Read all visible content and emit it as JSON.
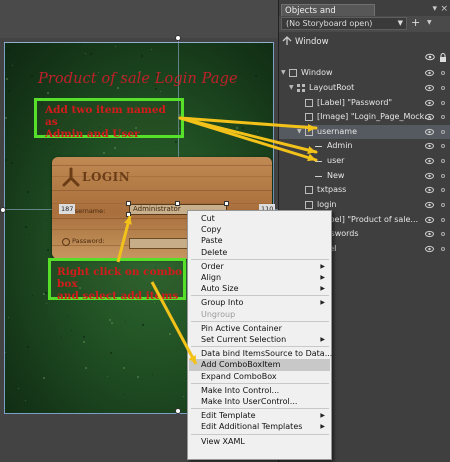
{
  "canvas": {
    "page_title": "Product of sale Login Page",
    "login_word": "LOGIN",
    "username_label": "Username:",
    "username_combo_text": "Administrator",
    "password_label": "Password:",
    "ruler_left": "187",
    "ruler_right": "110",
    "callout_top": [
      "Add two item named as",
      "Admin and User"
    ],
    "callout_bottom": [
      "Right click on combo box",
      "and select add items"
    ],
    "callout_color": "#56e02a",
    "callout_text_color": "#d41b1b",
    "arrow_color": "#f2c21a"
  },
  "context_menu": {
    "items": [
      {
        "label": "Cut",
        "submenu": false,
        "disabled": false
      },
      {
        "label": "Copy",
        "submenu": false,
        "disabled": false
      },
      {
        "label": "Paste",
        "submenu": false,
        "disabled": false
      },
      {
        "label": "Delete",
        "submenu": false,
        "disabled": false
      },
      {
        "label": "Order",
        "submenu": true,
        "disabled": false
      },
      {
        "label": "Align",
        "submenu": true,
        "disabled": false
      },
      {
        "label": "Auto Size",
        "submenu": true,
        "disabled": false
      },
      {
        "label": "Group Into",
        "submenu": true,
        "disabled": false
      },
      {
        "label": "Ungroup",
        "submenu": false,
        "disabled": true
      },
      {
        "label": "Pin Active Container",
        "submenu": false,
        "disabled": false
      },
      {
        "label": "Set Current Selection",
        "submenu": true,
        "disabled": false
      },
      {
        "label": "Data bind ItemsSource to Data...",
        "submenu": false,
        "disabled": false
      },
      {
        "label": "Add ComboBoxItem",
        "submenu": false,
        "disabled": false,
        "highlighted": true
      },
      {
        "label": "Expand ComboBox",
        "submenu": false,
        "disabled": false
      },
      {
        "label": "Make Into Control...",
        "submenu": false,
        "disabled": false
      },
      {
        "label": "Make Into UserControl...",
        "submenu": false,
        "disabled": false
      },
      {
        "label": "Edit Template",
        "submenu": true,
        "disabled": false
      },
      {
        "label": "Edit Additional Templates",
        "submenu": true,
        "disabled": false
      },
      {
        "label": "View XAML",
        "submenu": false,
        "disabled": false
      }
    ]
  },
  "panel": {
    "title": "Objects and Timeline",
    "pin": "▾",
    "close": "×",
    "storyboard": "(No Storyboard open)",
    "add": "+",
    "scope": "Window",
    "tree": [
      {
        "label": "Window",
        "depth": 0,
        "icon": "window-icon",
        "expanded": true
      },
      {
        "label": "LayoutRoot",
        "depth": 1,
        "icon": "grid-icon",
        "expanded": true
      },
      {
        "label": "[Label] \"Password\"",
        "depth": 2,
        "icon": "label-icon"
      },
      {
        "label": "[Image] \"Login_Page_Mock...",
        "depth": 2,
        "icon": "image-icon"
      },
      {
        "label": "username",
        "depth": 2,
        "icon": "combobox-icon",
        "expanded": true,
        "selected": true
      },
      {
        "label": "Admin",
        "depth": 3,
        "icon": "item-icon"
      },
      {
        "label": "user",
        "depth": 3,
        "icon": "item-icon"
      },
      {
        "label": "New",
        "depth": 3,
        "icon": "item-icon"
      },
      {
        "label": "txtpass",
        "depth": 2,
        "icon": "textbox-icon"
      },
      {
        "label": "login",
        "depth": 2,
        "icon": "button-icon"
      },
      {
        "label": "[Label] \"Product of sale...",
        "depth": 2,
        "icon": "label-icon"
      },
      {
        "label": "Passwords",
        "depth": 2,
        "icon": "textbox-icon"
      },
      {
        "label": "label",
        "depth": 2,
        "icon": "label-icon"
      }
    ]
  }
}
